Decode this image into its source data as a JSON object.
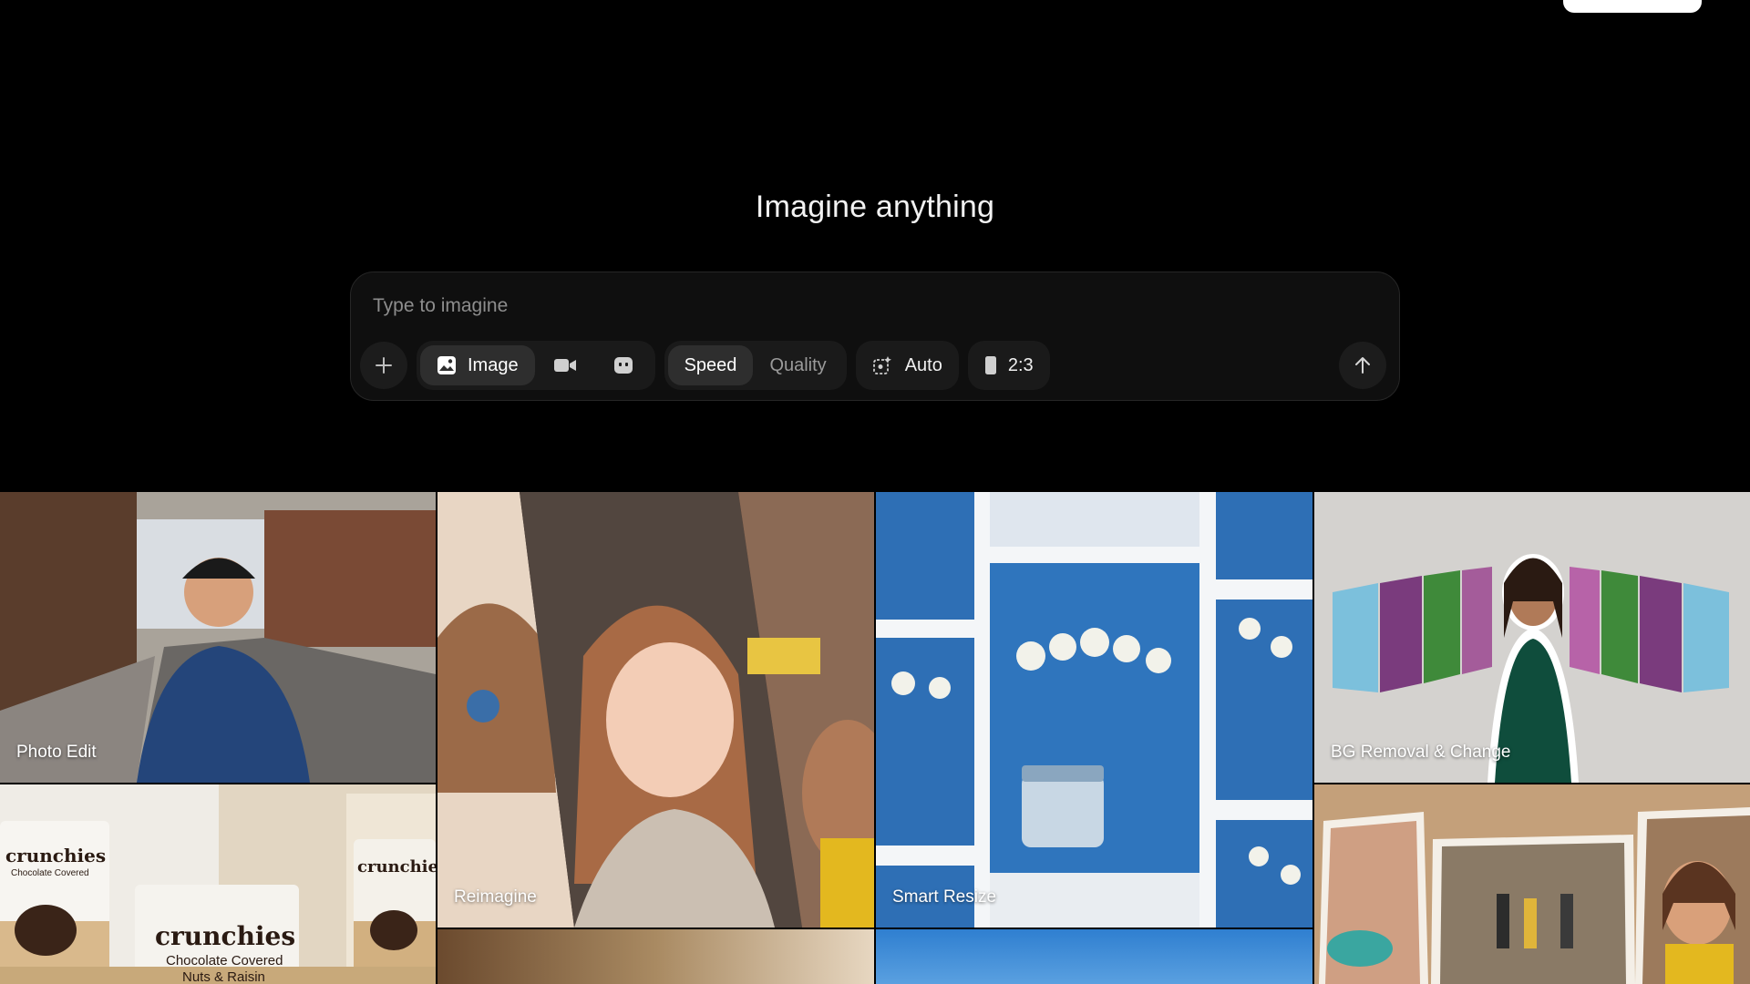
{
  "hero": {
    "title": "Imagine anything"
  },
  "composer": {
    "placeholder": "Type to imagine",
    "modes": {
      "image_label": "Image"
    },
    "quality": {
      "speed_label": "Speed",
      "quality_label": "Quality"
    },
    "style_label": "Auto",
    "aspect_label": "2:3"
  },
  "gallery": {
    "tiles": [
      {
        "label": "Photo Edit"
      },
      {
        "label": "Reimagine"
      },
      {
        "label": "Smart Resize"
      },
      {
        "label": "BG Removal & Change"
      }
    ],
    "product": {
      "brand": "crunchies",
      "line1": "Chocolate Covered",
      "line2": "Nuts & Raisin"
    }
  },
  "colors": {
    "background": "#000000",
    "accent": "#ffffff",
    "panel": "#0f0f0f"
  }
}
